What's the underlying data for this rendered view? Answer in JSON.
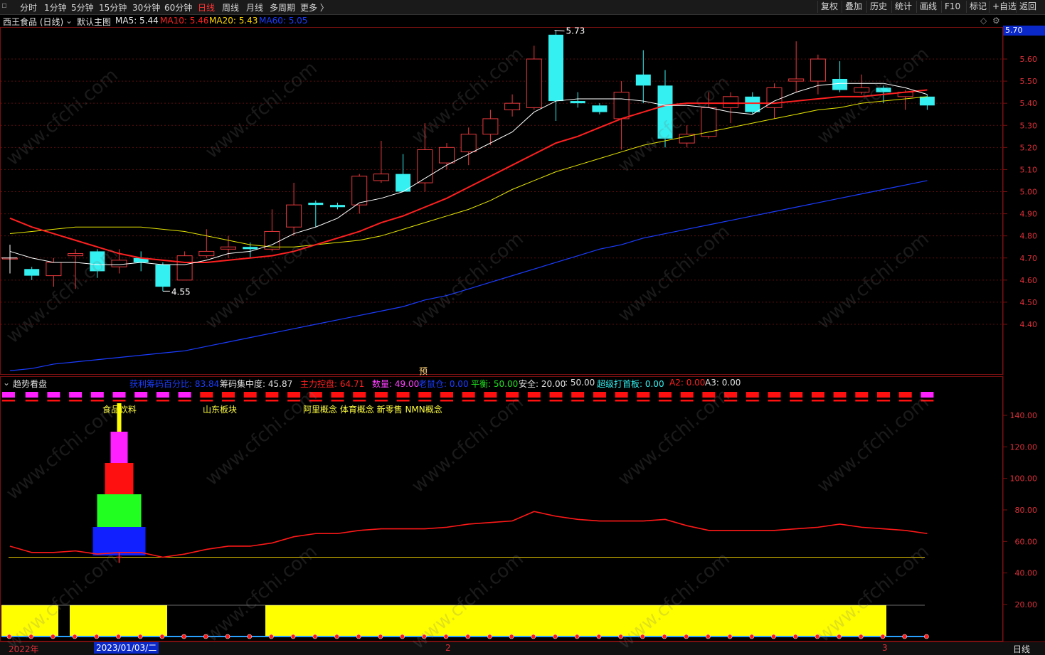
{
  "toolbar": {
    "left_items": [
      "分时",
      "1分钟",
      "5分钟",
      "15分钟",
      "30分钟",
      "60分钟",
      "日线",
      "周线",
      "月线",
      "多周期",
      "更多 〉"
    ],
    "active": "日线",
    "right_items": [
      "复权",
      "叠加",
      "历史",
      "统计",
      "画线",
      "F10",
      "标记",
      "+自选",
      "返回"
    ]
  },
  "main": {
    "stock": "西王食品 (日线)",
    "indicator_name": "默认主图",
    "ma5": "MA5: 5.44",
    "ma10": "MA10: 5.46",
    "ma20": "MA20: 5.43",
    "ma60": "MA60: 5.05",
    "current_price": "5.70",
    "high_label": "5.73",
    "low_label": "4.55",
    "price_axis": [
      "5.60",
      "5.50",
      "5.40",
      "5.30",
      "5.20",
      "5.10",
      "5.00",
      "4.90",
      "4.80",
      "4.70",
      "4.60",
      "4.50",
      "4.40"
    ],
    "pre_marker": "预"
  },
  "indicator": {
    "name": "趋势看盘",
    "profit_pct": "获利筹码百分比: 83.84",
    "concentration": "筹码集中度: 45.87",
    "main_control": "主力控盘: 64.71",
    "count": "数量: 49.00",
    "old_rat": "老鼠仓: 0.00",
    "balance": "平衡: 50.00",
    "safety": "安全: 20.00",
    "safety2": ": 50.00",
    "super_board": "超级打首板: 0.00",
    "a2": "A2: 0.00",
    "a3": "A3: 0.00",
    "concepts": [
      "食品饮料",
      "山东板块",
      "阿里概念 体育概念 新零售 NMN概念"
    ],
    "axis": [
      "140.00",
      "120.00",
      "100.00",
      "80.00",
      "60.00",
      "40.00",
      "20.00"
    ]
  },
  "bottom": {
    "year": "2022年",
    "date": "2023/01/03/二",
    "m2": "2",
    "m3": "3",
    "period": "日线"
  },
  "colors": {
    "up": "#e8393c",
    "down": "#34f0f0",
    "ma5": "#ffffff",
    "ma10": "#ff2020",
    "ma20": "#e6e600",
    "ma60": "#1a3cff",
    "bg": "#000000",
    "yellow": "#ffff00"
  },
  "chart_data": {
    "type": "candlestick",
    "candles": [
      {
        "o": 4.7,
        "c": 4.7,
        "h": 4.76,
        "l": 4.63
      },
      {
        "o": 4.65,
        "c": 4.62,
        "h": 4.66,
        "l": 4.6
      },
      {
        "o": 4.62,
        "c": 4.68,
        "h": 4.7,
        "l": 4.57
      },
      {
        "o": 4.71,
        "c": 4.72,
        "h": 4.74,
        "l": 4.56
      },
      {
        "o": 4.73,
        "c": 4.64,
        "h": 4.74,
        "l": 4.61
      },
      {
        "o": 4.66,
        "c": 4.69,
        "h": 4.74,
        "l": 4.63
      },
      {
        "o": 4.7,
        "c": 4.68,
        "h": 4.73,
        "l": 4.64
      },
      {
        "o": 4.67,
        "c": 4.57,
        "h": 4.68,
        "l": 4.55
      },
      {
        "o": 4.6,
        "c": 4.71,
        "h": 4.73,
        "l": 4.6
      },
      {
        "o": 4.71,
        "c": 4.73,
        "h": 4.83,
        "l": 4.7
      },
      {
        "o": 4.74,
        "c": 4.75,
        "h": 4.8,
        "l": 4.7
      },
      {
        "o": 4.75,
        "c": 4.74,
        "h": 4.77,
        "l": 4.7
      },
      {
        "o": 4.74,
        "c": 4.82,
        "h": 4.92,
        "l": 4.73
      },
      {
        "o": 4.84,
        "c": 4.94,
        "h": 5.04,
        "l": 4.8
      },
      {
        "o": 4.95,
        "c": 4.94,
        "h": 4.96,
        "l": 4.84
      },
      {
        "o": 4.94,
        "c": 4.93,
        "h": 4.95,
        "l": 4.92
      },
      {
        "o": 4.94,
        "c": 5.07,
        "h": 5.08,
        "l": 4.9
      },
      {
        "o": 5.05,
        "c": 5.08,
        "h": 5.23,
        "l": 5.04
      },
      {
        "o": 5.08,
        "c": 5.0,
        "h": 5.17,
        "l": 5.02
      },
      {
        "o": 5.04,
        "c": 5.19,
        "h": 5.31,
        "l": 5.0
      },
      {
        "o": 5.13,
        "c": 5.2,
        "h": 5.22,
        "l": 5.1
      },
      {
        "o": 5.18,
        "c": 5.26,
        "h": 5.29,
        "l": 5.12
      },
      {
        "o": 5.26,
        "c": 5.33,
        "h": 5.37,
        "l": 5.21
      },
      {
        "o": 5.37,
        "c": 5.4,
        "h": 5.44,
        "l": 5.34
      },
      {
        "o": 5.38,
        "c": 5.6,
        "h": 5.66,
        "l": 5.37
      },
      {
        "o": 5.71,
        "c": 5.41,
        "h": 5.73,
        "l": 5.32
      },
      {
        "o": 5.41,
        "c": 5.4,
        "h": 5.45,
        "l": 5.38
      },
      {
        "o": 5.39,
        "c": 5.36,
        "h": 5.4,
        "l": 5.35
      },
      {
        "o": 5.33,
        "c": 5.45,
        "h": 5.5,
        "l": 5.19
      },
      {
        "o": 5.53,
        "c": 5.48,
        "h": 5.64,
        "l": 5.4
      },
      {
        "o": 5.48,
        "c": 5.24,
        "h": 5.55,
        "l": 5.2
      },
      {
        "o": 5.22,
        "c": 5.26,
        "h": 5.3,
        "l": 5.2
      },
      {
        "o": 5.25,
        "c": 5.38,
        "h": 5.45,
        "l": 5.24
      },
      {
        "o": 5.38,
        "c": 5.43,
        "h": 5.45,
        "l": 5.31
      },
      {
        "o": 5.43,
        "c": 5.36,
        "h": 5.45,
        "l": 5.35
      },
      {
        "o": 5.38,
        "c": 5.47,
        "h": 5.49,
        "l": 5.33
      },
      {
        "o": 5.5,
        "c": 5.51,
        "h": 5.68,
        "l": 5.45
      },
      {
        "o": 5.5,
        "c": 5.6,
        "h": 5.62,
        "l": 5.44
      },
      {
        "o": 5.51,
        "c": 5.46,
        "h": 5.59,
        "l": 5.45
      },
      {
        "o": 5.45,
        "c": 5.47,
        "h": 5.53,
        "l": 5.44
      },
      {
        "o": 5.47,
        "c": 5.45,
        "h": 5.48,
        "l": 5.4
      },
      {
        "o": 5.43,
        "c": 5.45,
        "h": 5.46,
        "l": 5.37
      },
      {
        "o": 5.43,
        "c": 5.39,
        "h": 5.44,
        "l": 5.37
      }
    ],
    "ma5": [
      4.73,
      4.7,
      4.68,
      4.68,
      4.67,
      4.67,
      4.68,
      4.67,
      4.67,
      4.69,
      4.72,
      4.73,
      4.76,
      4.81,
      4.84,
      4.88,
      4.95,
      4.97,
      5.0,
      5.06,
      5.12,
      5.17,
      5.22,
      5.27,
      5.36,
      5.41,
      5.42,
      5.42,
      5.42,
      5.41,
      5.39,
      5.39,
      5.38,
      5.36,
      5.35,
      5.41,
      5.45,
      5.48,
      5.49,
      5.49,
      5.49,
      5.47,
      5.44
    ],
    "ma10": [
      4.88,
      4.84,
      4.81,
      4.78,
      4.75,
      4.72,
      4.7,
      4.69,
      4.68,
      4.68,
      4.69,
      4.7,
      4.71,
      4.73,
      4.76,
      4.79,
      4.82,
      4.86,
      4.89,
      4.93,
      4.97,
      5.02,
      5.07,
      5.12,
      5.17,
      5.22,
      5.25,
      5.29,
      5.33,
      5.36,
      5.39,
      5.4,
      5.4,
      5.4,
      5.4,
      5.4,
      5.41,
      5.42,
      5.43,
      5.43,
      5.44,
      5.45,
      5.46
    ],
    "ma20": [
      4.81,
      4.82,
      4.83,
      4.84,
      4.84,
      4.84,
      4.84,
      4.83,
      4.82,
      4.8,
      4.78,
      4.76,
      4.75,
      4.75,
      4.76,
      4.77,
      4.78,
      4.8,
      4.83,
      4.86,
      4.89,
      4.92,
      4.96,
      5.01,
      5.05,
      5.09,
      5.12,
      5.15,
      5.18,
      5.21,
      5.23,
      5.25,
      5.27,
      5.29,
      5.31,
      5.33,
      5.35,
      5.37,
      5.38,
      5.4,
      5.41,
      5.42,
      5.43
    ],
    "ma60": [
      4.19,
      4.2,
      4.22,
      4.23,
      4.24,
      4.25,
      4.26,
      4.27,
      4.28,
      4.3,
      4.32,
      4.34,
      4.36,
      4.38,
      4.4,
      4.42,
      4.44,
      4.46,
      4.48,
      4.51,
      4.53,
      4.56,
      4.59,
      4.62,
      4.65,
      4.68,
      4.71,
      4.74,
      4.76,
      4.79,
      4.81,
      4.83,
      4.85,
      4.87,
      4.89,
      4.91,
      4.93,
      4.95,
      4.97,
      4.99,
      5.01,
      5.03,
      5.05
    ],
    "price_ylim": [
      4.25,
      5.8
    ],
    "indicator_line": [
      57,
      53,
      53,
      54,
      52,
      53,
      53,
      50,
      52,
      55,
      57,
      57,
      59,
      63,
      65,
      65,
      67,
      68,
      68,
      68,
      69,
      71,
      72,
      73,
      79,
      76,
      74,
      73,
      73,
      73,
      74,
      70,
      67,
      67,
      67,
      67,
      68,
      69,
      71,
      69,
      68,
      67,
      65
    ],
    "indicator_ref": 50,
    "indicator_ylim": [
      0,
      160
    ],
    "yellow_bars": [
      1,
      1,
      1,
      0,
      1,
      1,
      1,
      1,
      0,
      0,
      0,
      1,
      1,
      1,
      1,
      1,
      1,
      1,
      1,
      1,
      1,
      1,
      1,
      1,
      1,
      1,
      1,
      1,
      1,
      1,
      1,
      1,
      1,
      1,
      1,
      1,
      1,
      1,
      1,
      1,
      0,
      0
    ],
    "top_markers": [
      "m",
      "m",
      "m",
      "m",
      "m",
      "m",
      "m",
      "m",
      "m",
      "r",
      "r",
      "r",
      "r",
      "r",
      "r",
      "r",
      "r",
      "r",
      "r",
      "r",
      "r",
      "r",
      "r",
      "r",
      "r",
      "r",
      "r",
      "r",
      "r",
      "r",
      "r",
      "r",
      "r",
      "r",
      "r",
      "r",
      "r",
      "r",
      "r",
      "r",
      "r",
      "r",
      "m"
    ]
  }
}
